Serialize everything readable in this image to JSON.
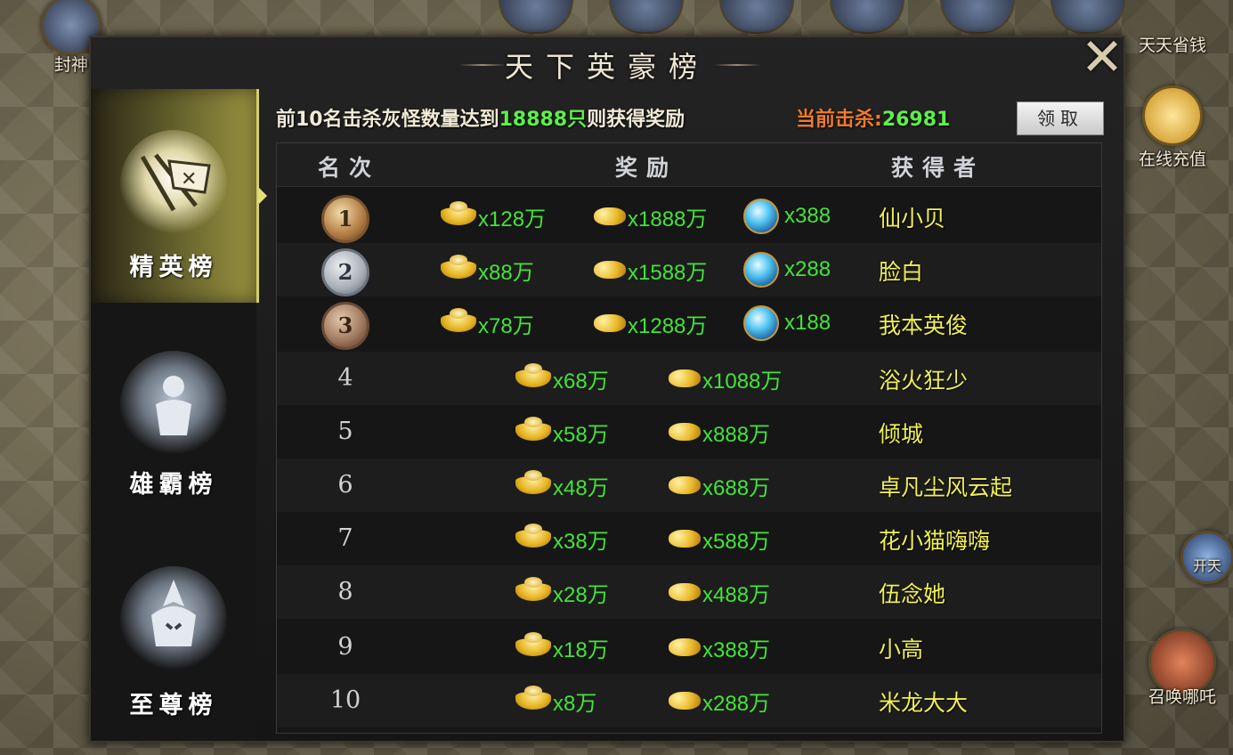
{
  "background": {
    "left_top_button": "封神",
    "right_top_button": "天天省钱",
    "right_recharge_button": "在线充值",
    "right_side_button": "开天",
    "right_summon_button": "召唤哪吒"
  },
  "panel": {
    "title": "天下英豪榜",
    "close_icon": "close-icon"
  },
  "tabs": [
    {
      "label": "精英榜",
      "active": true,
      "icon": "flag-emblem-icon"
    },
    {
      "label": "雄霸榜",
      "active": false,
      "icon": "warrior-emblem-icon"
    },
    {
      "label": "至尊榜",
      "active": false,
      "icon": "helm-emblem-icon"
    }
  ],
  "info": {
    "req_prefix": "前10名击杀灰怪数量达到",
    "req_target": "18888只",
    "req_suffix": "则获得奖励",
    "kill_label": "当前击杀:",
    "kill_value": "26981",
    "claim_button": "领取"
  },
  "table": {
    "headers": {
      "rank": "名次",
      "reward": "奖励",
      "winner": "获得者"
    },
    "rows": [
      {
        "rank": "1",
        "ingot": "x128万",
        "gold": "x1888万",
        "orb": "x388",
        "winner": "仙小贝"
      },
      {
        "rank": "2",
        "ingot": "x88万",
        "gold": "x1588万",
        "orb": "x288",
        "winner": "脸白"
      },
      {
        "rank": "3",
        "ingot": "x78万",
        "gold": "x1288万",
        "orb": "x188",
        "winner": "我本英俊"
      },
      {
        "rank": "4",
        "ingot": "x68万",
        "gold": "x1088万",
        "winner": "浴火狂少"
      },
      {
        "rank": "5",
        "ingot": "x58万",
        "gold": "x888万",
        "winner": "倾城"
      },
      {
        "rank": "6",
        "ingot": "x48万",
        "gold": "x688万",
        "winner": "卓凡尘风云起"
      },
      {
        "rank": "7",
        "ingot": "x38万",
        "gold": "x588万",
        "winner": "花小猫嗨嗨"
      },
      {
        "rank": "8",
        "ingot": "x28万",
        "gold": "x488万",
        "winner": "伍念她"
      },
      {
        "rank": "9",
        "ingot": "x18万",
        "gold": "x388万",
        "winner": "小高"
      },
      {
        "rank": "10",
        "ingot": "x8万",
        "gold": "x288万",
        "winner": "米龙大大"
      }
    ]
  },
  "colors": {
    "reward_value": "#43e33a",
    "winner": "#f0ef55",
    "kill_label": "#f07a2c",
    "active_tab": "#9a9340"
  }
}
